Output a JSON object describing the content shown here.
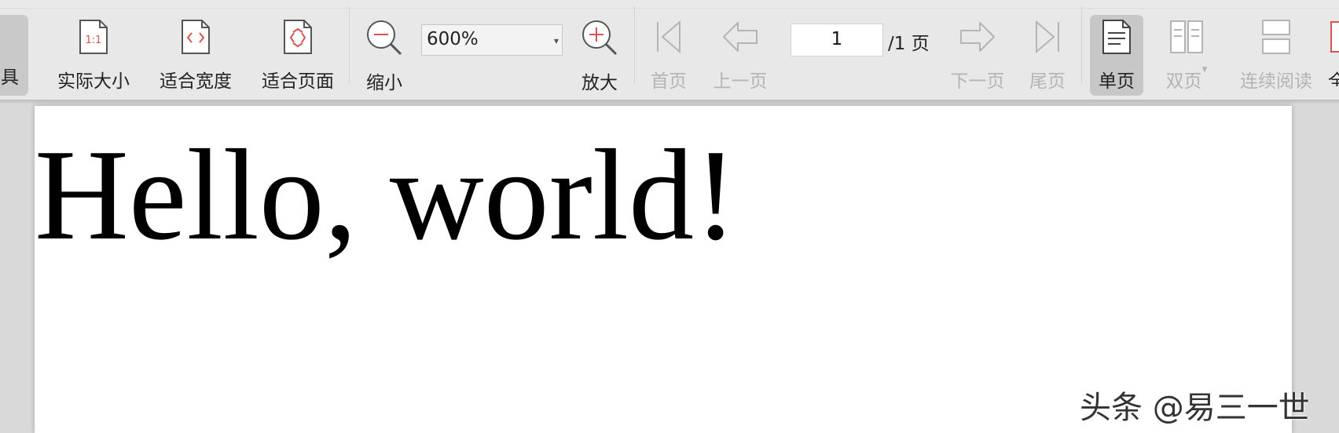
{
  "toolbar": {
    "partial_left_label": "具",
    "actual_size_label": "实际大小",
    "fit_width_label": "适合宽度",
    "fit_page_label": "适合页面",
    "zoom_out_label": "缩小",
    "zoom_value": "600%",
    "zoom_in_label": "放大",
    "first_page_label": "首页",
    "prev_page_label": "上一页",
    "current_page": "1",
    "page_total": "/1 页",
    "next_page_label": "下一页",
    "last_page_label": "尾页",
    "single_page_label": "单页",
    "double_page_label": "双页",
    "continuous_label": "连续阅读",
    "partial_right_label": "全",
    "actual_size_icon_text": "1:1"
  },
  "document": {
    "text": "Hello, world!"
  },
  "watermark": {
    "text": "头条 @易三一世"
  },
  "colors": {
    "toolbar_bg": "#e8e8e8",
    "accent_red": "#d9534f",
    "active_bg": "#c7c7c7",
    "disabled_text": "#b4b4b4"
  },
  "icons": {
    "actual_size": "actual-size-icon",
    "fit_width": "fit-width-icon",
    "fit_page": "fit-page-icon",
    "zoom_out": "zoom-out-icon",
    "zoom_in": "zoom-in-icon",
    "first_page": "first-page-icon",
    "prev_page": "prev-page-icon",
    "next_page": "next-page-icon",
    "last_page": "last-page-icon",
    "single_page": "single-page-icon",
    "double_page": "double-page-icon",
    "continuous": "continuous-read-icon"
  }
}
